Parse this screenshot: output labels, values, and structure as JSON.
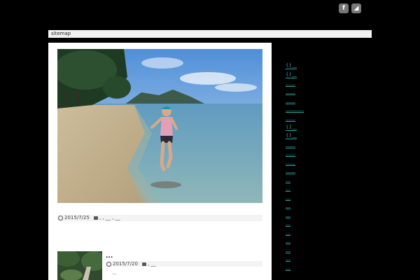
{
  "header": {
    "social_icons": [
      {
        "icon": "feedly-icon",
        "glyph": "f"
      },
      {
        "icon": "rss-icon",
        "glyph": "◢"
      }
    ]
  },
  "nav": {
    "items": [
      {
        "label": "sitemap"
      }
    ]
  },
  "posts": [
    {
      "date": "2015/7/25",
      "categories": ", , __ , __"
    },
    {
      "title": "...",
      "date": "2015/7/20",
      "categories": ", __",
      "excerpt": "..."
    }
  ],
  "sidebar": {
    "links": [
      {
        "text": "{}__"
      },
      {
        "text": "{}__"
      },
      {
        "text": "____"
      },
      {
        "text": "____"
      },
      {
        "text": "____"
      },
      {
        "text": "________"
      },
      {
        "text": "____"
      },
      {
        "text": "{}__"
      },
      {
        "text": "{}__"
      },
      {
        "text": "____"
      },
      {
        "text": "____"
      },
      {
        "text": "____"
      },
      {
        "text": "____"
      },
      {
        "text": "__"
      },
      {
        "text": "__"
      },
      {
        "text": "__"
      },
      {
        "text": "__"
      },
      {
        "text": "__"
      },
      {
        "text": "__"
      },
      {
        "text": "__"
      },
      {
        "text": "__"
      },
      {
        "text": "__"
      },
      {
        "text": "__"
      },
      {
        "text": "__"
      }
    ]
  },
  "colors": {
    "background": "#000000",
    "accent": "#2aa7a7",
    "nav_bar": "#f2f2f2"
  }
}
